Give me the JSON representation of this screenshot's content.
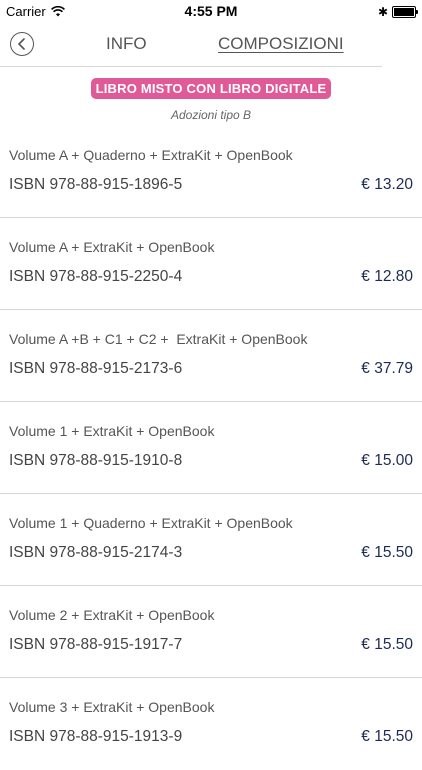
{
  "status": {
    "carrier": "Carrier",
    "time": "4:55 PM"
  },
  "nav": {
    "tab_info": "INFO",
    "tab_composizioni": "COMPOSIZIONI"
  },
  "badge": {
    "label": "LIBRO MISTO CON LIBRO DIGITALE",
    "subtitle": "Adozioni tipo B",
    "color": "#e05a97"
  },
  "accent_price_color": "#1d2a55",
  "items": [
    {
      "title": "Volume A + Quaderno + ExtraKit + OpenBook",
      "isbn": "ISBN 978-88-915-1896-5",
      "price": "€ 13.20"
    },
    {
      "title": "Volume A + ExtraKit + OpenBook",
      "isbn": "ISBN 978-88-915-2250-4",
      "price": "€ 12.80"
    },
    {
      "title": "Volume A +B + C1 + C2 +  ExtraKit + OpenBook",
      "isbn": "ISBN 978-88-915-2173-6",
      "price": "€ 37.79"
    },
    {
      "title": "Volume 1 + ExtraKit + OpenBook",
      "isbn": "ISBN 978-88-915-1910-8",
      "price": "€ 15.00"
    },
    {
      "title": "Volume 1 + Quaderno + ExtraKit + OpenBook",
      "isbn": "ISBN 978-88-915-2174-3",
      "price": "€ 15.50"
    },
    {
      "title": "Volume 2 + ExtraKit + OpenBook",
      "isbn": "ISBN 978-88-915-1917-7",
      "price": "€ 15.50"
    },
    {
      "title": "Volume 3 + ExtraKit + OpenBook",
      "isbn": "ISBN 978-88-915-1913-9",
      "price": "€ 15.50"
    }
  ]
}
